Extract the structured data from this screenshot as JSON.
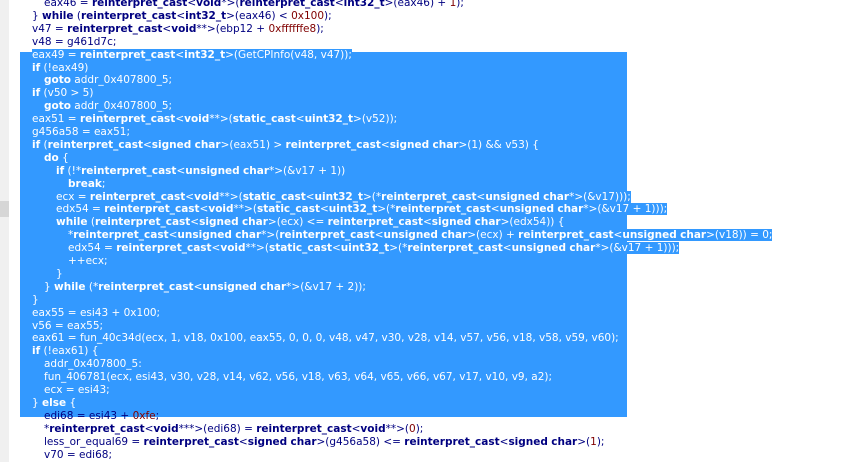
{
  "lines": [
    {
      "indent": 5,
      "selected": false,
      "text": "eax46 = reinterpret_cast<void*>(reinterpret_cast<int32_t>(eax46) + 1);"
    },
    {
      "indent": 4,
      "selected": false,
      "text": "} while (reinterpret_cast<int32_t>(eax46) < 0x100);"
    },
    {
      "indent": 4,
      "selected": false,
      "text": "v47 = reinterpret_cast<void**>(ebp12 + 0xffffffe8);"
    },
    {
      "indent": 4,
      "selected": false,
      "text": "v48 = g461d7c;"
    },
    {
      "indent": 4,
      "selected": true,
      "text": "eax49 = reinterpret_cast<int32_t>(GetCPInfo(v48, v47));"
    },
    {
      "indent": 4,
      "selected": true,
      "text": "if (!eax49)"
    },
    {
      "indent": 5,
      "selected": true,
      "text": "goto addr_0x407800_5;"
    },
    {
      "indent": 4,
      "selected": true,
      "text": "if (v50 > 5)"
    },
    {
      "indent": 5,
      "selected": true,
      "text": "goto addr_0x407800_5;"
    },
    {
      "indent": 4,
      "selected": true,
      "text": "eax51 = reinterpret_cast<void**>(static_cast<uint32_t>(v52));"
    },
    {
      "indent": 4,
      "selected": true,
      "text": "g456a58 = eax51;"
    },
    {
      "indent": 4,
      "selected": true,
      "text": "if (reinterpret_cast<signed char>(eax51) > reinterpret_cast<signed char>(1) && v53) {"
    },
    {
      "indent": 5,
      "selected": true,
      "text": "do {"
    },
    {
      "indent": 6,
      "selected": true,
      "text": "if (!*reinterpret_cast<unsigned char*>(&v17 + 1))"
    },
    {
      "indent": 7,
      "selected": true,
      "text": "break;"
    },
    {
      "indent": 6,
      "selected": true,
      "text": "ecx = reinterpret_cast<void**>(static_cast<uint32_t>(*reinterpret_cast<unsigned char*>(&v17)));"
    },
    {
      "indent": 6,
      "selected": true,
      "text": "edx54 = reinterpret_cast<void**>(static_cast<uint32_t>(*reinterpret_cast<unsigned char*>(&v17 + 1)));"
    },
    {
      "indent": 6,
      "selected": true,
      "text": "while (reinterpret_cast<signed char>(ecx) <= reinterpret_cast<signed char>(edx54)) {"
    },
    {
      "indent": 7,
      "selected": true,
      "text": "*reinterpret_cast<unsigned char*>(reinterpret_cast<unsigned char>(ecx) + reinterpret_cast<unsigned char>(v18)) = 0;"
    },
    {
      "indent": 7,
      "selected": true,
      "text": "edx54 = reinterpret_cast<void**>(static_cast<uint32_t>(*reinterpret_cast<unsigned char*>(&v17 + 1)));"
    },
    {
      "indent": 7,
      "selected": true,
      "text": "++ecx;"
    },
    {
      "indent": 6,
      "selected": true,
      "text": "}"
    },
    {
      "indent": 5,
      "selected": true,
      "text": "} while (*reinterpret_cast<unsigned char*>(&v17 + 2));"
    },
    {
      "indent": 4,
      "selected": true,
      "text": "}"
    },
    {
      "indent": 4,
      "selected": true,
      "text": "eax55 = esi43 + 0x100;"
    },
    {
      "indent": 4,
      "selected": true,
      "text": "v56 = eax55;"
    },
    {
      "indent": 4,
      "selected": true,
      "text": "eax61 = fun_40c34d(ecx, 1, v18, 0x100, eax55, 0, 0, 0, v48, v47, v30, v28, v14, v57, v56, v18, v58, v59, v60);"
    },
    {
      "indent": 4,
      "selected": true,
      "text": "if (!eax61) {"
    },
    {
      "indent": 5,
      "selected": true,
      "text": "addr_0x407800_5:"
    },
    {
      "indent": 5,
      "selected": true,
      "text": "fun_406781(ecx, esi43, v30, v28, v14, v62, v56, v18, v63, v64, v65, v66, v67, v17, v10, v9, a2);"
    },
    {
      "indent": 5,
      "selected": true,
      "text": "ecx = esi43;"
    },
    {
      "indent": 4,
      "selected": true,
      "text": "} else {"
    },
    {
      "indent": 5,
      "selected": false,
      "text": "edi68 = esi43 + 0xfe;"
    },
    {
      "indent": 5,
      "selected": false,
      "text": "*reinterpret_cast<void***>(edi68) = reinterpret_cast<void**>(0);"
    },
    {
      "indent": 5,
      "selected": false,
      "text": "less_or_equal69 = reinterpret_cast<signed char>(g456a58) <= reinterpret_cast<signed char>(1);"
    },
    {
      "indent": 5,
      "selected": false,
      "text": "v70 = edi68;"
    }
  ],
  "colors": {
    "selection": "#3399ff",
    "selected_text": "#ffffff",
    "code_text": "#000080",
    "number": "#800000"
  }
}
